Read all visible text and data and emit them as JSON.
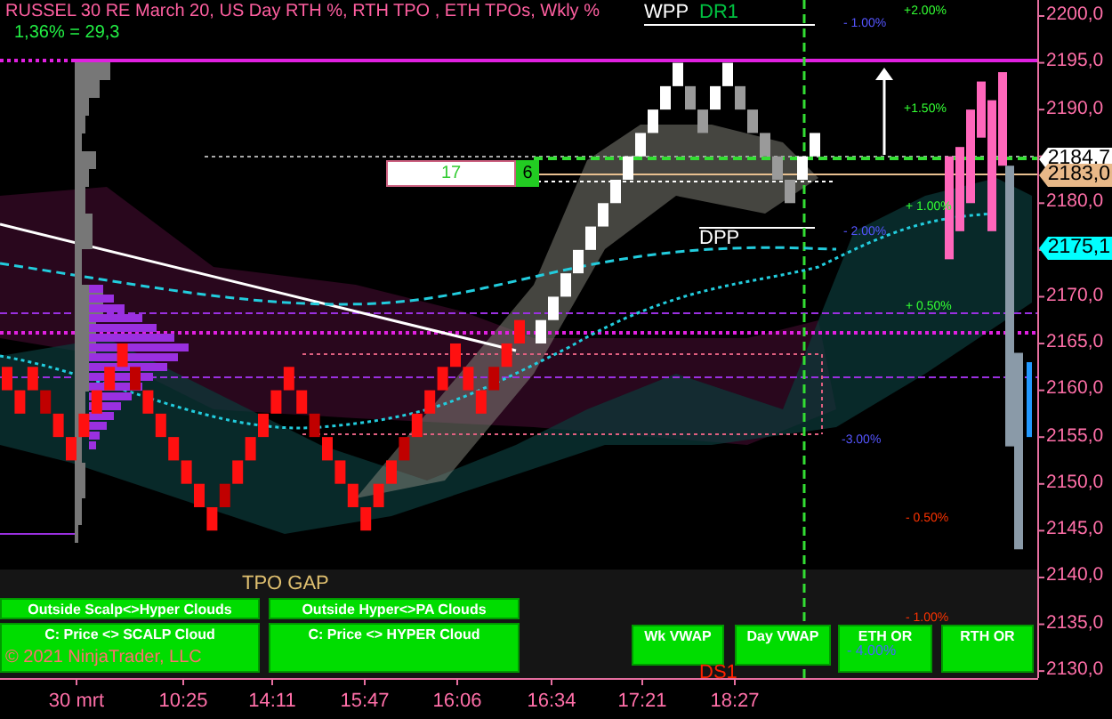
{
  "chart": {
    "title": "RUSSEL 30 RE March 20, US Day RTH %, RTH TPO , ETH TPOs, Wkly %",
    "subtitle": "1,36% = 29,3",
    "copyright": "© 2021 NinjaTrader, LLC"
  },
  "price_axis": [
    "2200,0",
    "2195,0",
    "2190,0",
    "2180,0",
    "2170,0",
    "2165,0",
    "2160,0",
    "2155,0",
    "2150,0",
    "2145,0",
    "2140,0",
    "2135,0",
    "2130,0"
  ],
  "time_axis": [
    "30 mrt",
    "10:25",
    "14:11",
    "15:47",
    "16:06",
    "16:34",
    "17:21",
    "18:27"
  ],
  "level_labels": [
    {
      "text": "WPP",
      "color": "#ffffff"
    },
    {
      "text": "DR1",
      "color": "#00c040"
    },
    {
      "text": "+2.00%",
      "color": "#33ff33"
    },
    {
      "text": "- 1.00%",
      "color": "#5555ff"
    },
    {
      "text": "+1.50%",
      "color": "#33ff33"
    },
    {
      "text": "+ 1.00%",
      "color": "#33ff33"
    },
    {
      "text": "- 2.00%",
      "color": "#5555ff"
    },
    {
      "text": "DPP",
      "color": "#ffffff"
    },
    {
      "text": "+ 0.50%",
      "color": "#33ff33"
    },
    {
      "text": "-3.00%",
      "color": "#5555ff"
    },
    {
      "text": "- 0.50%",
      "color": "#ff3300"
    },
    {
      "text": "- 1.00%",
      "color": "#ff3300"
    },
    {
      "text": "TPO GAP",
      "color": "#e0c070"
    },
    {
      "text": "DS1",
      "color": "#ff2200"
    }
  ],
  "price_tags": [
    {
      "text": "2184,7",
      "color": "#ffffff"
    },
    {
      "text": "2183,0",
      "color": "#e8b888"
    },
    {
      "text": "2175,1",
      "color": "#00ffff"
    }
  ],
  "brick_counter": {
    "value": "17",
    "count": "6"
  },
  "buttons": [
    {
      "label": "Outside Scalp<>Hyper Clouds"
    },
    {
      "label": "Outside Hyper<>PA Clouds"
    },
    {
      "label": "C: Price <> SCALP Cloud"
    },
    {
      "label": "C: Price <> HYPER Cloud"
    },
    {
      "label": "Wk VWAP"
    },
    {
      "label": "Day VWAP"
    },
    {
      "label": "ETH OR",
      "note": "- 4.00%"
    },
    {
      "label": "RTH OR"
    }
  ]
}
